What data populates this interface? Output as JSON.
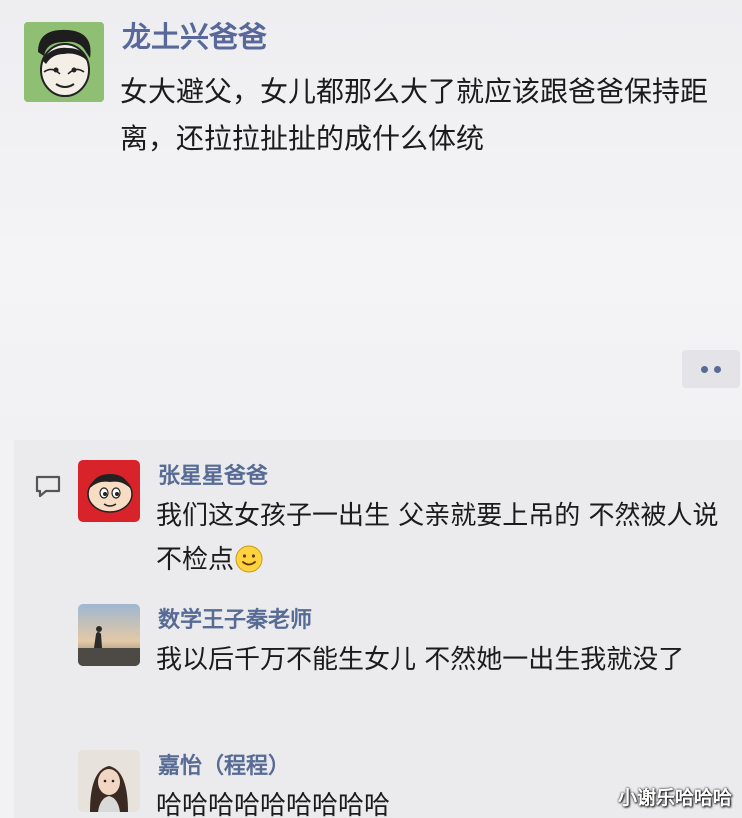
{
  "post": {
    "author": "龙土兴爸爸",
    "text": "女大避父，女儿都那么大了就应该跟爸爸保持距离，还拉拉扯扯的成什么体统",
    "avatar_icon": "cartoon-boy-avatar-icon",
    "more_icon": "more-dots-icon"
  },
  "comments": [
    {
      "author": "张星星爸爸",
      "text": "我们这女孩子一出生  父亲就要上吊的  不然被人说不检点",
      "emoji": "smile-emoji-icon",
      "avatar_icon": "crayon-shinchan-avatar-icon"
    },
    {
      "author": "数学王子秦老师",
      "text": "我以后千万不能生女儿  不然她一出生我就没了",
      "avatar_icon": "sunset-photo-avatar-icon"
    },
    {
      "author": "嘉怡（程程）",
      "text": "哈哈哈哈哈哈哈哈哈",
      "avatar_icon": "girl-photo-avatar-icon"
    }
  ],
  "comment_icon": "comment-bubble-icon",
  "watermark": "小谢乐哈哈哈",
  "colors": {
    "name": "#576b95",
    "text": "#1b1b1b",
    "background": "#f2f2f4"
  }
}
